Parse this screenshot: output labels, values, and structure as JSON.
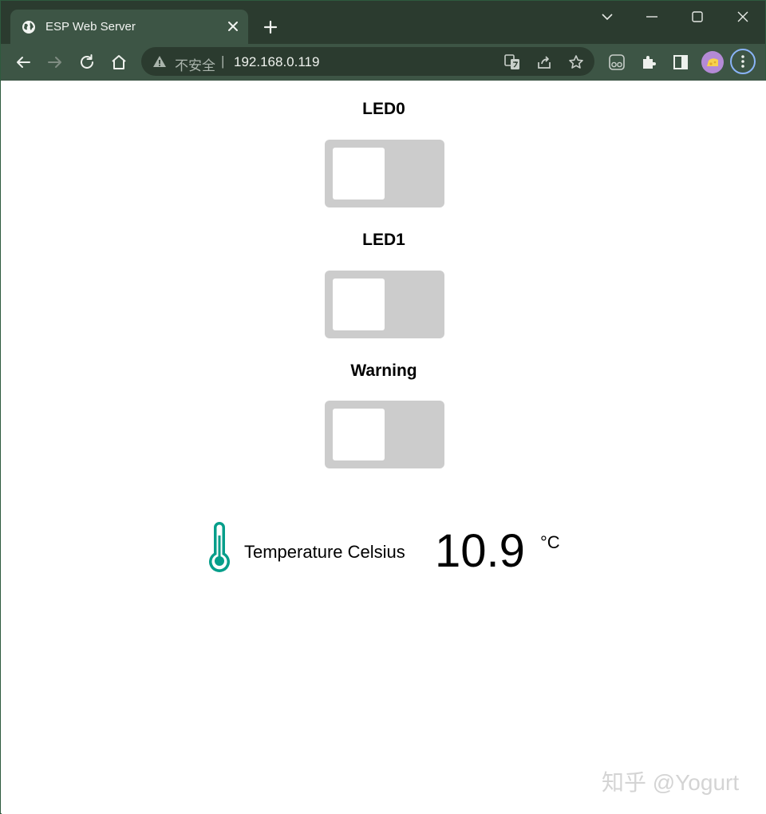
{
  "tab": {
    "title": "ESP Web Server"
  },
  "address_bar": {
    "security_label": "不安全",
    "separator": "|",
    "url": "192.168.0.119"
  },
  "page": {
    "switches": [
      {
        "label": "LED0",
        "state": "off"
      },
      {
        "label": "LED1",
        "state": "off"
      },
      {
        "label": "Warning",
        "state": "off"
      }
    ],
    "temperature": {
      "label": "Temperature Celsius",
      "value": "10.9",
      "unit": "°C",
      "icon": "thermometer-icon",
      "icon_color": "#059e8a"
    }
  },
  "watermark": "知乎 @Yogurt",
  "colors": {
    "tabbar": "#2b3b2f",
    "toolbar": "#3d5545",
    "switch_off": "#cccccc",
    "focus_ring": "#8ab4f8"
  }
}
